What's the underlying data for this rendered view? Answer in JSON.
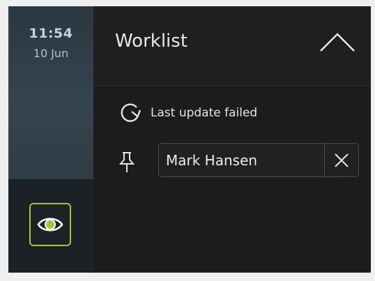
{
  "clock": {
    "time": "11:54",
    "date": "10 Jun"
  },
  "worklist": {
    "title": "Worklist",
    "status_text": "Last update failed",
    "pinned_patient": "Mark Hansen"
  },
  "icons": {
    "collapse": "chevron-up-icon",
    "refresh": "refresh-icon",
    "pin": "pin-icon",
    "clear": "close-icon",
    "view": "eye-icon"
  },
  "colors": {
    "accent": "#a9c43a",
    "background": "#1b1c1d",
    "rail": "#2f3a42"
  }
}
